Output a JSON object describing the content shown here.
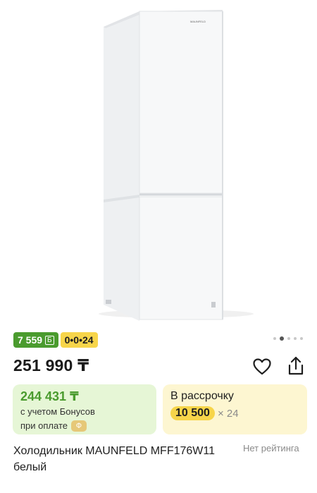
{
  "product": {
    "image_alt": "Холодильник MAUNFELD MFF176W11 белый",
    "brand_mark": "MAUNFELD",
    "name": "Холодильник MAUNFELD MFF176W11 белый",
    "rating": "Нет рейтинга"
  },
  "badges": {
    "bonus_amount": "7 559",
    "bonus_icon": "Б",
    "installment": "0•0•24"
  },
  "gallery": {
    "total_dots": 5,
    "active_index": 1
  },
  "price": "251 990 ₸",
  "actions": {
    "favorite_icon": "heart-icon",
    "share_icon": "share-icon"
  },
  "bonus_card": {
    "amount": "244 431 ₸",
    "line1": "с учетом Бонусов",
    "line2": "при оплате",
    "pill_icon": "Ф"
  },
  "installment_card": {
    "title": "В рассрочку",
    "monthly": "10 500",
    "months": "× 24"
  },
  "colors": {
    "bonus_green": "#4a9b2e",
    "installment_yellow": "#f7d54a",
    "bonus_card_bg": "#e6f6d6",
    "installment_card_bg": "#fdf6d1"
  }
}
